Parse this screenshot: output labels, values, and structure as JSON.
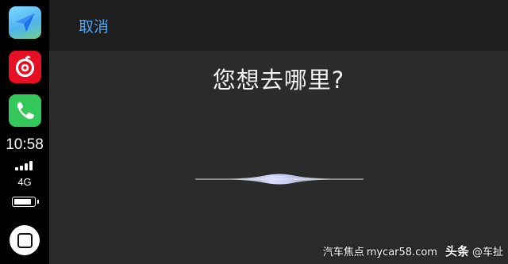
{
  "sidebar": {
    "apps": [
      {
        "name": "maps",
        "icon": "maps-navigation-icon"
      },
      {
        "name": "netease-music",
        "icon": "music-icon"
      },
      {
        "name": "phone",
        "icon": "phone-icon"
      }
    ],
    "time": "10:58",
    "network": "4G",
    "signal_bars": 4,
    "home_icon": "home-button-icon"
  },
  "header": {
    "cancel_label": "取消"
  },
  "main": {
    "prompt": "您想去哪里?"
  },
  "watermark": {
    "left": "汽车焦点",
    "site": "mycar58.com",
    "toutiao": "头条",
    "at": "@车扯"
  },
  "colors": {
    "accent": "#4aa3ec",
    "background": "#2b2b2b",
    "topbar": "#1e1e1e",
    "sidebar": "#000000"
  }
}
